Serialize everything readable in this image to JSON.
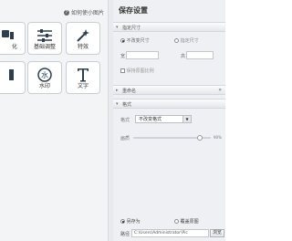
{
  "left": {
    "hint": "如何使小图片",
    "tiles": [
      {
        "label": "化",
        "icon": "partial-icon"
      },
      {
        "label": "基础调整",
        "icon": "sliders-icon"
      },
      {
        "label": "特效",
        "icon": "magic-wand-icon"
      },
      {
        "label": "",
        "icon": "partial-icon"
      },
      {
        "label": "水印",
        "icon": "watermark-stamp-icon"
      },
      {
        "label": "文字",
        "icon": "text-T-icon"
      }
    ]
  },
  "right": {
    "title": "保存设置",
    "size_section": {
      "header": "指定尺寸",
      "option_original": "不改变尺寸",
      "option_custom": "指定尺寸",
      "width_label": "宽",
      "height_label": "高",
      "width_placeholder": "",
      "height_placeholder": "",
      "keep_ratio": "保持原图比例"
    },
    "rename_section": {
      "header": "重命名",
      "toggle": "»"
    },
    "format_section": {
      "header": "格式",
      "format_label": "格式",
      "format_value": "不改变格式",
      "quality_label": "画质",
      "quality_value": "90%",
      "quality_fraction": 0.86
    },
    "save_options": {
      "option_saveas": "另存为",
      "option_overwrite": "覆盖原图",
      "path_label": "路径",
      "path_value": "C:\\Users\\Administrator\\Pic",
      "browse_button": "浏览"
    }
  }
}
